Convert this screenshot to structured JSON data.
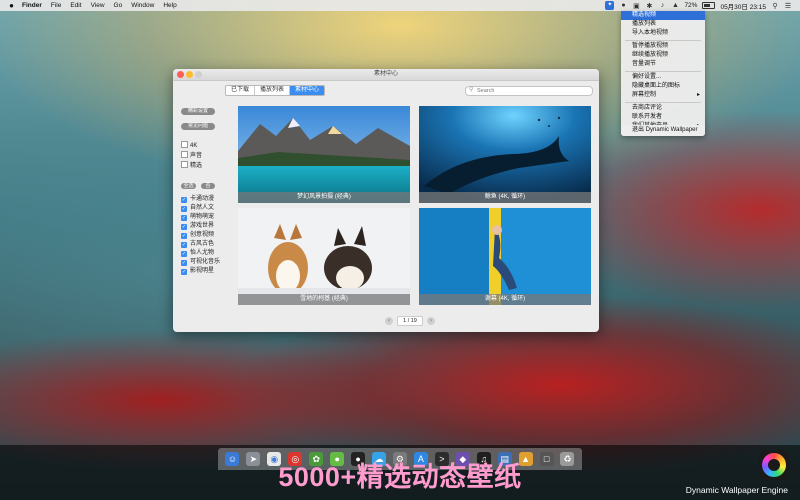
{
  "menubar": {
    "apple": "",
    "items": [
      "Finder",
      "File",
      "Edit",
      "View",
      "Go",
      "Window",
      "Help"
    ],
    "battery": "72%",
    "datetime": "05月30日 23:15"
  },
  "dropdown": {
    "items": [
      "精选视频",
      "播放列表",
      "导入本地视频",
      "暂停播放视频",
      "继续播放视频",
      "音量调节",
      "偏好设置...",
      "隐藏桌面上的图标",
      "屏幕控制",
      "去商店评论",
      "联系开发者",
      "我们其他产品",
      "退出 Dynamic Wallpaper"
    ],
    "highlighted_index": 0
  },
  "window": {
    "title": "素材中心",
    "tabs": [
      {
        "label": "已下载",
        "active": false
      },
      {
        "label": "播放列表",
        "active": false
      },
      {
        "label": "素材中心",
        "active": true
      }
    ],
    "search_placeholder": "Search",
    "sidebar": {
      "featured_label": "精彩设置",
      "common_label": "常见问题",
      "resolutions": [
        "4K",
        "声音",
        "精选"
      ],
      "select_all": "全选",
      "invert": "否",
      "categories": [
        "卡通动漫",
        "自然人文",
        "萌物萌宠",
        "游戏世界",
        "创意视频",
        "古风古色",
        "怡人尤物",
        "可视化音乐",
        "影视明星"
      ]
    },
    "cards": [
      {
        "caption": "梦幻风景拍摄 (经典)"
      },
      {
        "caption": "鲸鱼 (4K, 循环)"
      },
      {
        "caption": "雪地的柯基 (经典)"
      },
      {
        "caption": "谢幕 (4K, 循环)"
      }
    ],
    "pager": {
      "text": "1 / 19"
    }
  },
  "banner": {
    "title": "5000+精选动态壁纸",
    "app_name": "Dynamic Wallpaper Engine"
  },
  "colors": {
    "accent": "#3b8cf0",
    "banner_text": "#ff9ccd",
    "menu_highlight": "#2f6fd8"
  }
}
